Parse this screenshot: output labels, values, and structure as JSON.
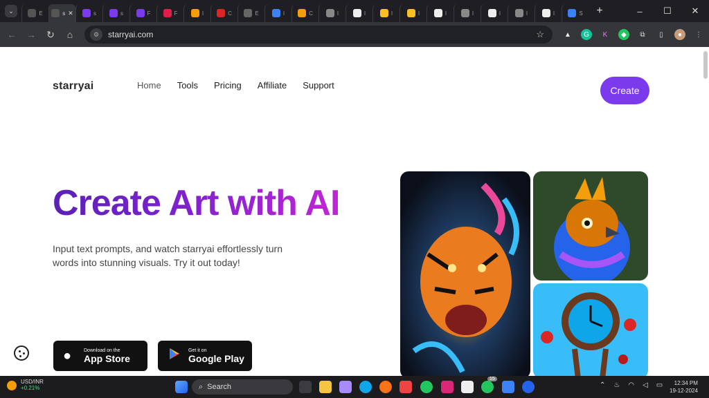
{
  "browser": {
    "url": "starryai.com",
    "tabs": [
      {
        "label": "E",
        "icon": "starryai-favicon"
      },
      {
        "label": "s",
        "icon": "starryai-favicon",
        "active": true
      },
      {
        "label": "s",
        "icon": "plus-favicon"
      },
      {
        "label": "s",
        "icon": "plus-favicon"
      },
      {
        "label": "F",
        "icon": "plus-favicon"
      },
      {
        "label": "F",
        "icon": "mc-favicon"
      },
      {
        "label": "I",
        "icon": "w-favicon"
      },
      {
        "label": "C",
        "icon": "o-favicon"
      },
      {
        "label": "E",
        "icon": "openai-favicon"
      },
      {
        "label": "I",
        "icon": "gemini-favicon"
      },
      {
        "label": "C",
        "icon": "flag-favicon"
      },
      {
        "label": "I",
        "icon": "chrome-favicon"
      },
      {
        "label": "I",
        "icon": "google-favicon"
      },
      {
        "label": "I",
        "icon": "ads-favicon"
      },
      {
        "label": "I",
        "icon": "ads-favicon"
      },
      {
        "label": "I",
        "icon": "google-favicon"
      },
      {
        "label": "I",
        "icon": "chrome-favicon"
      },
      {
        "label": "I",
        "icon": "google-favicon"
      },
      {
        "label": "I",
        "icon": "chrome-favicon"
      },
      {
        "label": "I",
        "icon": "google-favicon"
      },
      {
        "label": "S",
        "icon": "search-favicon"
      }
    ]
  },
  "site": {
    "logo": "starryai",
    "nav": [
      "Home",
      "Tools",
      "Pricing",
      "Affiliate",
      "Support"
    ],
    "create_button": "Create",
    "hero_title": "Create Art with AI",
    "hero_subtitle": "Input text prompts, and watch starryai effortlessly turn words into stunning visuals. Try it out today!",
    "app_store": {
      "small": "Download on the",
      "big": "App Store"
    },
    "google_play": {
      "small": "Get it on",
      "big": "Google Play"
    }
  },
  "taskbar": {
    "currency": "USD/INR",
    "change": "+0.21%",
    "search": "Search",
    "time": "12:34 PM",
    "date": "19-12-2024",
    "whatsapp_badge": "15"
  },
  "colors": {
    "accent": "#7c3aed",
    "page_bg": "#ffffff",
    "chrome": "#1f1f23"
  }
}
